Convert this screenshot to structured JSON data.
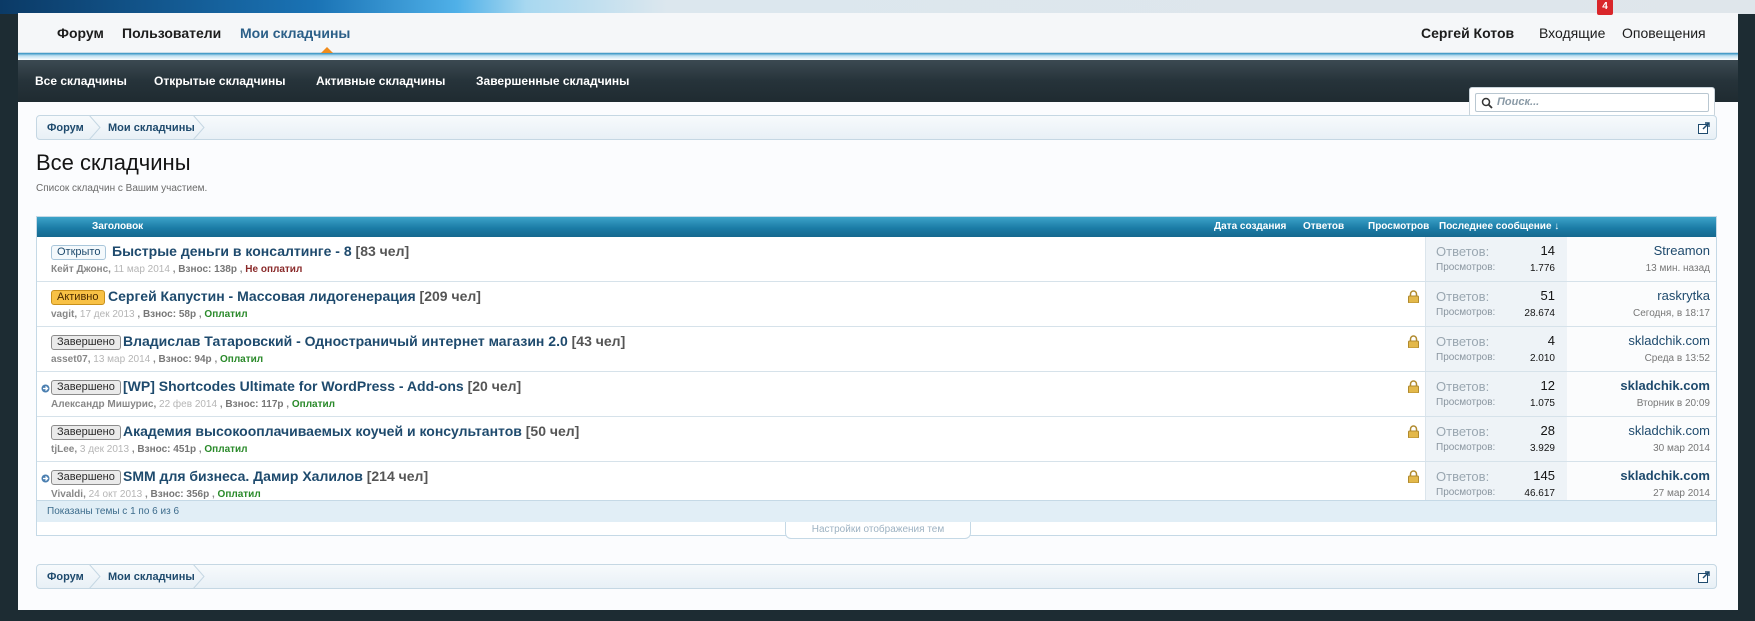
{
  "nav": {
    "tabs": [
      {
        "label": "Форум"
      },
      {
        "label": "Пользователи"
      },
      {
        "label": "Мои складчины"
      }
    ],
    "user": "Сергей Котов",
    "inbox": "Входящие",
    "inbox_badge": "4",
    "alerts": "Оповещения"
  },
  "subnav": {
    "links": [
      "Все складчины",
      "Открытые складчины",
      "Активные складчины",
      "Завершенные складчины"
    ]
  },
  "search": {
    "placeholder": "Поиск..."
  },
  "breadcrumb": {
    "items": [
      "Форум",
      "Мои складчины"
    ]
  },
  "page": {
    "title": "Все складчины",
    "description": "Список складчин с Вашим участием."
  },
  "table": {
    "headers": {
      "title": "Заголовок",
      "created": "Дата создания",
      "replies": "Ответов",
      "views": "Просмотров",
      "last": "Последнее сообщение ↓"
    },
    "stat_labels": {
      "replies": "Ответов:",
      "views": "Просмотров:"
    },
    "rows": [
      {
        "prefix": "Открыто",
        "title": "Быстрые деньги в консалтинге - 8",
        "members": "[83 чел]",
        "author": "Кейт Джонс",
        "date": "11 мар 2014",
        "fee": "Взнос: 138р",
        "status": "Не оплатил",
        "replies": "14",
        "views": "1.776",
        "last_user": "Streamon",
        "last_time": "13 мин. назад"
      },
      {
        "prefix": "Активно",
        "title": "Сергей Капустин - Массовая лидогенерация",
        "members": "[209 чел]",
        "author": "vagit",
        "date": "17 дек 2013",
        "fee": "Взнос: 58р",
        "status": "Оплатил",
        "replies": "51",
        "views": "28.674",
        "last_user": "raskrytka",
        "last_time": "Сегодня, в 18:17"
      },
      {
        "prefix": "Завершено",
        "title": "Владислав Татаровский - Одностраничый интернет магазин 2.0",
        "members": "[43 чел]",
        "author": "asset07",
        "date": "13 мар 2014",
        "fee": "Взнос: 94р",
        "status": "Оплатил",
        "replies": "4",
        "views": "2.010",
        "last_user": "skladchik.com",
        "last_time": "Среда в 13:52"
      },
      {
        "prefix": "Завершено",
        "title": "[WP] Shortcodes Ultimate for WordPress - Add-ons",
        "members": "[20 чел]",
        "author": "Александр Мишурис",
        "date": "22 фев 2014",
        "fee": "Взнос: 117р",
        "status": "Оплатил",
        "replies": "12",
        "views": "1.075",
        "last_user": "skladchik.com",
        "last_time": "Вторник в 20:09"
      },
      {
        "prefix": "Завершено",
        "title": "Академия высокооплачиваемых коучей и консультантов",
        "members": "[50 чел]",
        "author": "tjLee",
        "date": "3 дек 2013",
        "fee": "Взнос: 451р",
        "status": "Оплатил",
        "replies": "28",
        "views": "3.929",
        "last_user": "skladchik.com",
        "last_time": "30 мар 2014"
      },
      {
        "prefix": "Завершено",
        "title": "SMM для бизнеса. Дамир Халилов",
        "members": "[214 чел]",
        "author": "Vivaldi",
        "date": "24 окт 2013",
        "fee": "Взнос: 356р",
        "status": "Оплатил",
        "replies": "145",
        "views": "46.617",
        "last_user": "skladchik.com",
        "last_time": "27 мар 2014"
      }
    ],
    "footer": "Показаны темы с 1 по 6 из 6"
  },
  "settings_tab": "Настройки отображения тем",
  "colors": {
    "accent": "#1e4a6d",
    "header_blue": "#1b7ca6",
    "active_orange": "#f08c1c",
    "paid_green": "#2a8a2a"
  }
}
